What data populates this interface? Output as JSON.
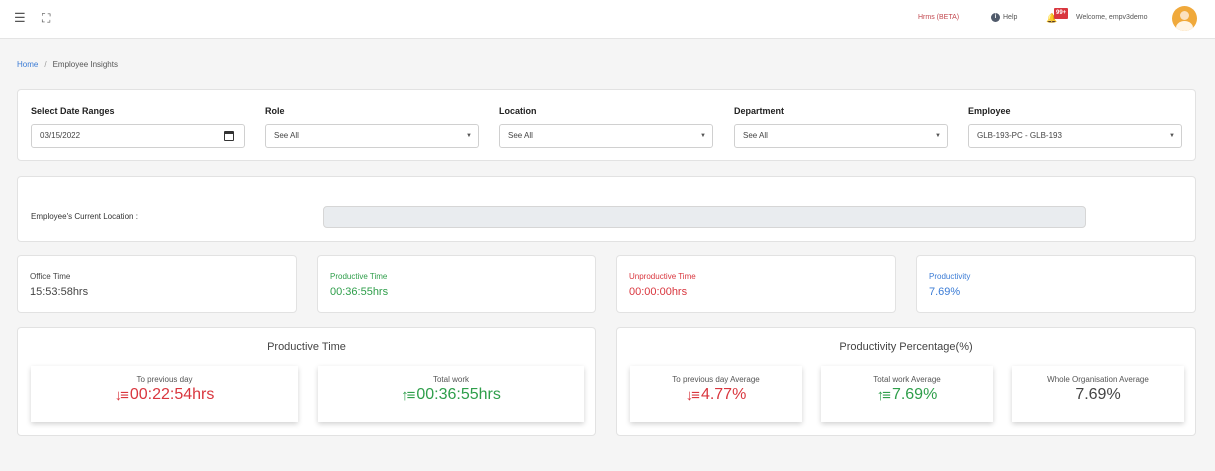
{
  "topbar": {
    "hrms_label": "Hrms (BETA)",
    "help_label": "Help",
    "notification_badge": "99+",
    "welcome_text": "Welcome, empv3demo"
  },
  "breadcrumb": {
    "home": "Home",
    "separator": "/",
    "current": "Employee Insights"
  },
  "filters": {
    "date": {
      "label": "Select Date Ranges",
      "value": "03/15/2022"
    },
    "role": {
      "label": "Role",
      "value": "See All"
    },
    "location": {
      "label": "Location",
      "value": "See All"
    },
    "department": {
      "label": "Department",
      "value": "See All"
    },
    "employee": {
      "label": "Employee",
      "value": "GLB-193-PC - GLB-193"
    }
  },
  "current_location": {
    "label": "Employee's Current Location :",
    "value": ""
  },
  "stats": [
    {
      "label": "Office Time",
      "value": "15:53:58hrs",
      "color": "#444444"
    },
    {
      "label": "Productive Time",
      "value": "00:36:55hrs",
      "color": "#2e9e4a"
    },
    {
      "label": "Unproductive Time",
      "value": "00:00:00hrs",
      "color": "#d9363e"
    },
    {
      "label": "Productivity",
      "value": "7.69%",
      "color": "#3a7bd5"
    }
  ],
  "productive_time": {
    "title": "Productive Time",
    "previous_day": {
      "label": "To previous day",
      "value": "00:22:54hrs",
      "trend": "down"
    },
    "total_work": {
      "label": "Total work",
      "value": "00:36:55hrs",
      "trend": "up"
    }
  },
  "productivity_percentage": {
    "title": "Productivity Percentage(%)",
    "previous_day_avg": {
      "label": "To previous day Average",
      "value": "4.77%",
      "trend": "down"
    },
    "total_work_avg": {
      "label": "Total work Average",
      "value": "7.69%",
      "trend": "up"
    },
    "org_avg": {
      "label": "Whole Organisation Average",
      "value": "7.69%"
    }
  },
  "icons": {
    "menu": "menu-icon",
    "fullscreen": "fullscreen-icon",
    "help": "info-icon",
    "bell": "bell-icon",
    "calendar": "calendar-icon",
    "down_trend": "sort-down-icon",
    "up_trend": "sort-up-icon"
  }
}
